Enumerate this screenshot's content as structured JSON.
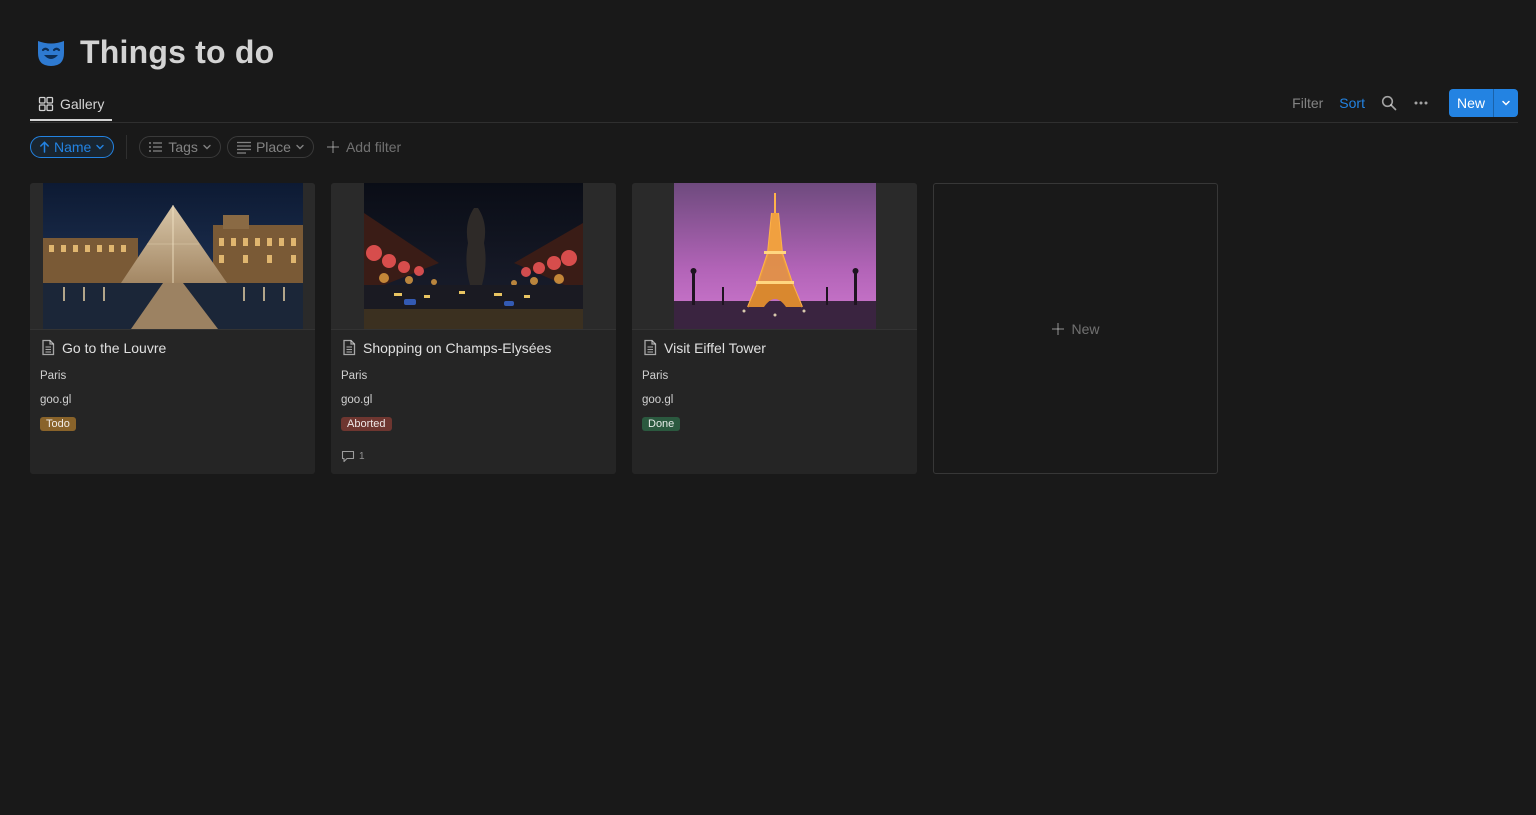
{
  "page": {
    "title": "Things to do",
    "icon": "theater-mask-icon"
  },
  "viewbar": {
    "tab_label": "Gallery",
    "filter_label": "Filter",
    "sort_label": "Sort",
    "new_label": "New"
  },
  "filters": {
    "sort_chip": "Name",
    "tags_chip": "Tags",
    "place_chip": "Place",
    "add_filter": "Add filter"
  },
  "cards": [
    {
      "title": "Go to the Louvre",
      "place": "Paris",
      "link": "goo.gl",
      "status": "Todo",
      "status_color": "#89632a"
    },
    {
      "title": "Shopping on Champs-Elysées",
      "place": "Paris",
      "link": "goo.gl",
      "status": "Aborted",
      "status_color": "#6e3630",
      "comments": "1"
    },
    {
      "title": "Visit Eiffel Tower",
      "place": "Paris",
      "link": "goo.gl",
      "status": "Done",
      "status_color": "#2b593f"
    }
  ],
  "new_card_label": "New",
  "colors": {
    "accent": "#2383e2",
    "background": "#191919",
    "card": "#252525"
  }
}
